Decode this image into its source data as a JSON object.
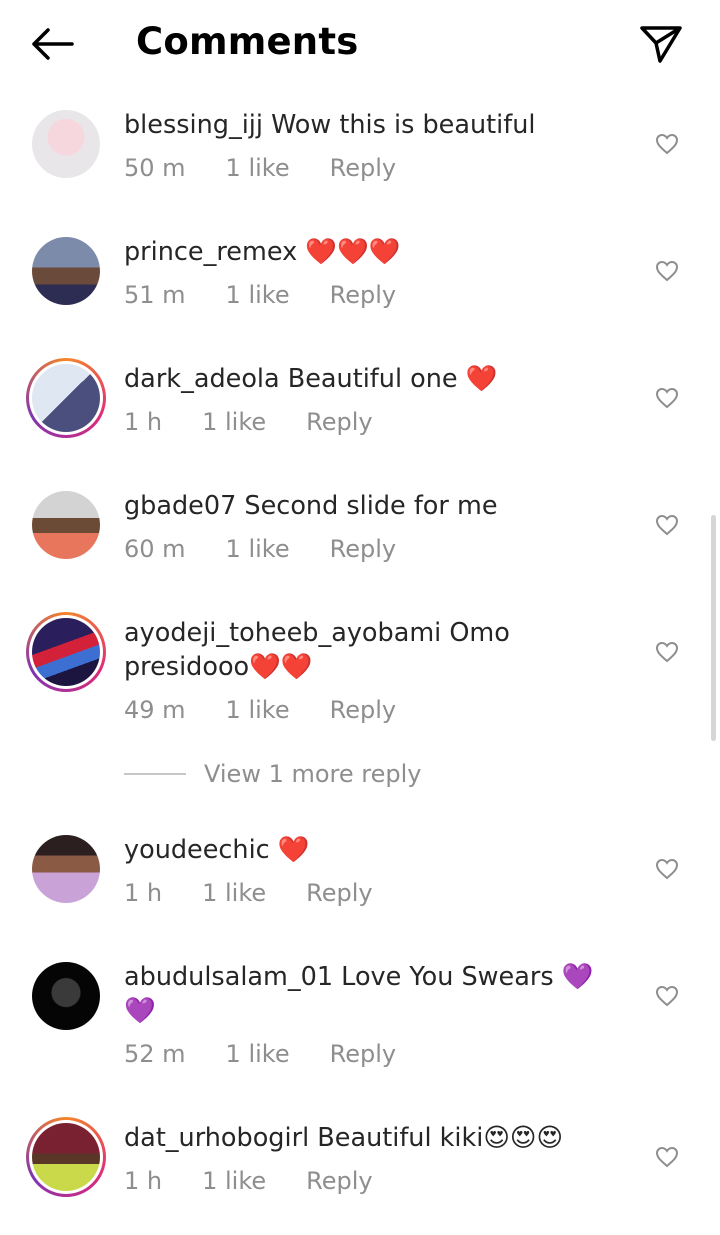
{
  "header": {
    "title": "Comments",
    "back_icon": "arrow-left-icon",
    "send_icon": "paper-plane-icon"
  },
  "comments": [
    {
      "username": "blessing_ijj",
      "text": " Wow this is beautiful",
      "time": "50 m",
      "likes": "1 like",
      "reply": "Reply",
      "story_ring": false,
      "avatar_colors": [
        "#e9e6ea",
        "#f7d7de"
      ]
    },
    {
      "username": "prince_remex",
      "text": " ❤️❤️❤️",
      "time": "51 m",
      "likes": "1 like",
      "reply": "Reply",
      "story_ring": false,
      "avatar_colors": [
        "#6b7b98",
        "#2d2c52"
      ]
    },
    {
      "username": "dark_adeola",
      "text": " Beautiful one ❤️",
      "time": "1 h",
      "likes": "1 like",
      "reply": "Reply",
      "story_ring": true,
      "avatar_colors": [
        "#cfd8e6",
        "#4b4f7d"
      ]
    },
    {
      "username": "gbade07",
      "text": " Second slide for me",
      "time": "60 m",
      "likes": "1 like",
      "reply": "Reply",
      "story_ring": false,
      "avatar_colors": [
        "#c9c9c9",
        "#e8765d"
      ]
    },
    {
      "username": "ayodeji_toheeb_ayobami",
      "text": " Omo presidooo❤️❤️",
      "time": "49 m",
      "likes": "1 like",
      "reply": "Reply",
      "story_ring": true,
      "avatar_colors": [
        "#2a1e5c",
        "#d3213a"
      ]
    },
    {
      "username": "youdeechic",
      "text": " ❤️",
      "time": "1 h",
      "likes": "1 like",
      "reply": "Reply",
      "story_ring": false,
      "avatar_colors": [
        "#3a2b2b",
        "#c9a3d8"
      ]
    },
    {
      "username": "abudulsalam_01",
      "text": " Love You Swears 💜💜",
      "time": "52 m",
      "likes": "1 like",
      "reply": "Reply",
      "story_ring": false,
      "avatar_colors": [
        "#111111",
        "#000000"
      ]
    },
    {
      "username": "dat_urhobogirl",
      "text": " Beautiful kiki😍😍😍",
      "time": "1 h",
      "likes": "1 like",
      "reply": "Reply",
      "story_ring": true,
      "avatar_colors": [
        "#7a2131",
        "#c9d94a"
      ]
    }
  ],
  "view_more_replies": "View 1 more reply",
  "heart_icon": "heart-outline-icon"
}
